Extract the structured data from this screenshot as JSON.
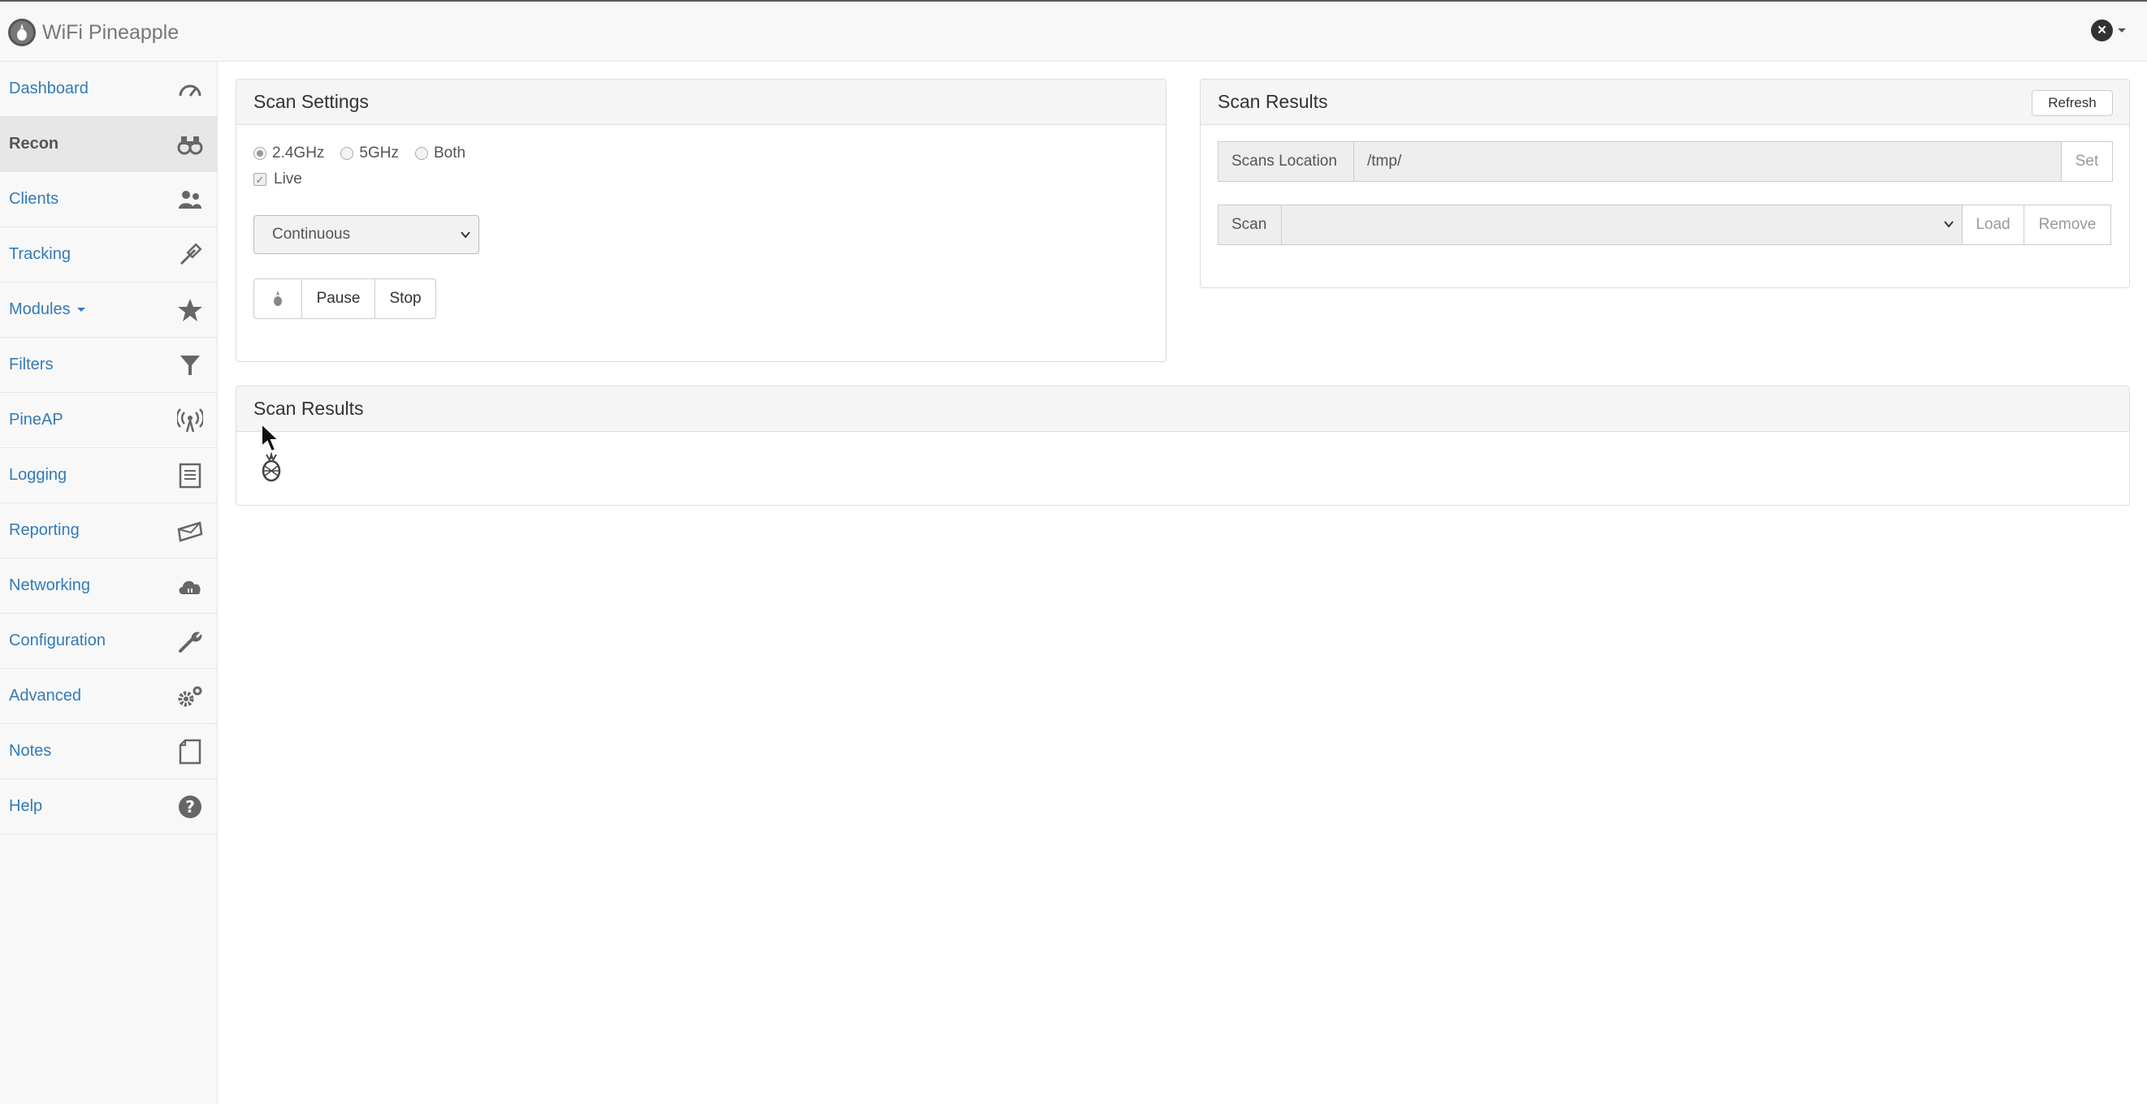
{
  "app": {
    "title": "WiFi Pineapple",
    "logo_icon": "pineapple-logo-icon",
    "top_right_icon": "close-circle-icon"
  },
  "colors": {
    "link": "#337ab7",
    "navbar_bg": "#f8f8f8",
    "panel_heading_bg": "#f5f5f5",
    "active_item_bg": "#e7e7e7"
  },
  "sidebar": {
    "items": [
      {
        "label": "Dashboard",
        "icon": "speedometer-icon",
        "active": false
      },
      {
        "label": "Recon",
        "icon": "binoculars-icon",
        "active": true
      },
      {
        "label": "Clients",
        "icon": "users-icon",
        "active": false
      },
      {
        "label": "Tracking",
        "icon": "satellite-icon",
        "active": false
      },
      {
        "label": "Modules",
        "icon": "star-icon",
        "active": false,
        "dropdown": true
      },
      {
        "label": "Filters",
        "icon": "filter-icon",
        "active": false
      },
      {
        "label": "PineAP",
        "icon": "antenna-icon",
        "active": false
      },
      {
        "label": "Logging",
        "icon": "document-icon",
        "active": false
      },
      {
        "label": "Reporting",
        "icon": "envelope-icon",
        "active": false
      },
      {
        "label": "Networking",
        "icon": "cloud-icon",
        "active": false
      },
      {
        "label": "Configuration",
        "icon": "wrench-icon",
        "active": false
      },
      {
        "label": "Advanced",
        "icon": "gears-icon",
        "active": false
      },
      {
        "label": "Notes",
        "icon": "page-icon",
        "active": false
      },
      {
        "label": "Help",
        "icon": "question-icon",
        "active": false
      }
    ]
  },
  "scan_settings": {
    "title": "Scan Settings",
    "bands": [
      {
        "label": "2.4GHz",
        "checked": true
      },
      {
        "label": "5GHz",
        "checked": false
      },
      {
        "label": "Both",
        "checked": false
      }
    ],
    "live_label": "Live",
    "live_checked": true,
    "mode_selected": "Continuous",
    "buttons": {
      "start_icon": "pineapple-icon",
      "pause": "Pause",
      "stop": "Stop"
    }
  },
  "scan_results_top": {
    "title": "Scan Results",
    "refresh": "Refresh",
    "location_label": "Scans Location",
    "location_value": "/tmp/",
    "set": "Set",
    "scan_label": "Scan",
    "scan_selected": "",
    "load": "Load",
    "remove": "Remove"
  },
  "scan_results_bottom": {
    "title": "Scan Results",
    "loading_icon": "pineapple-spinner-icon"
  }
}
